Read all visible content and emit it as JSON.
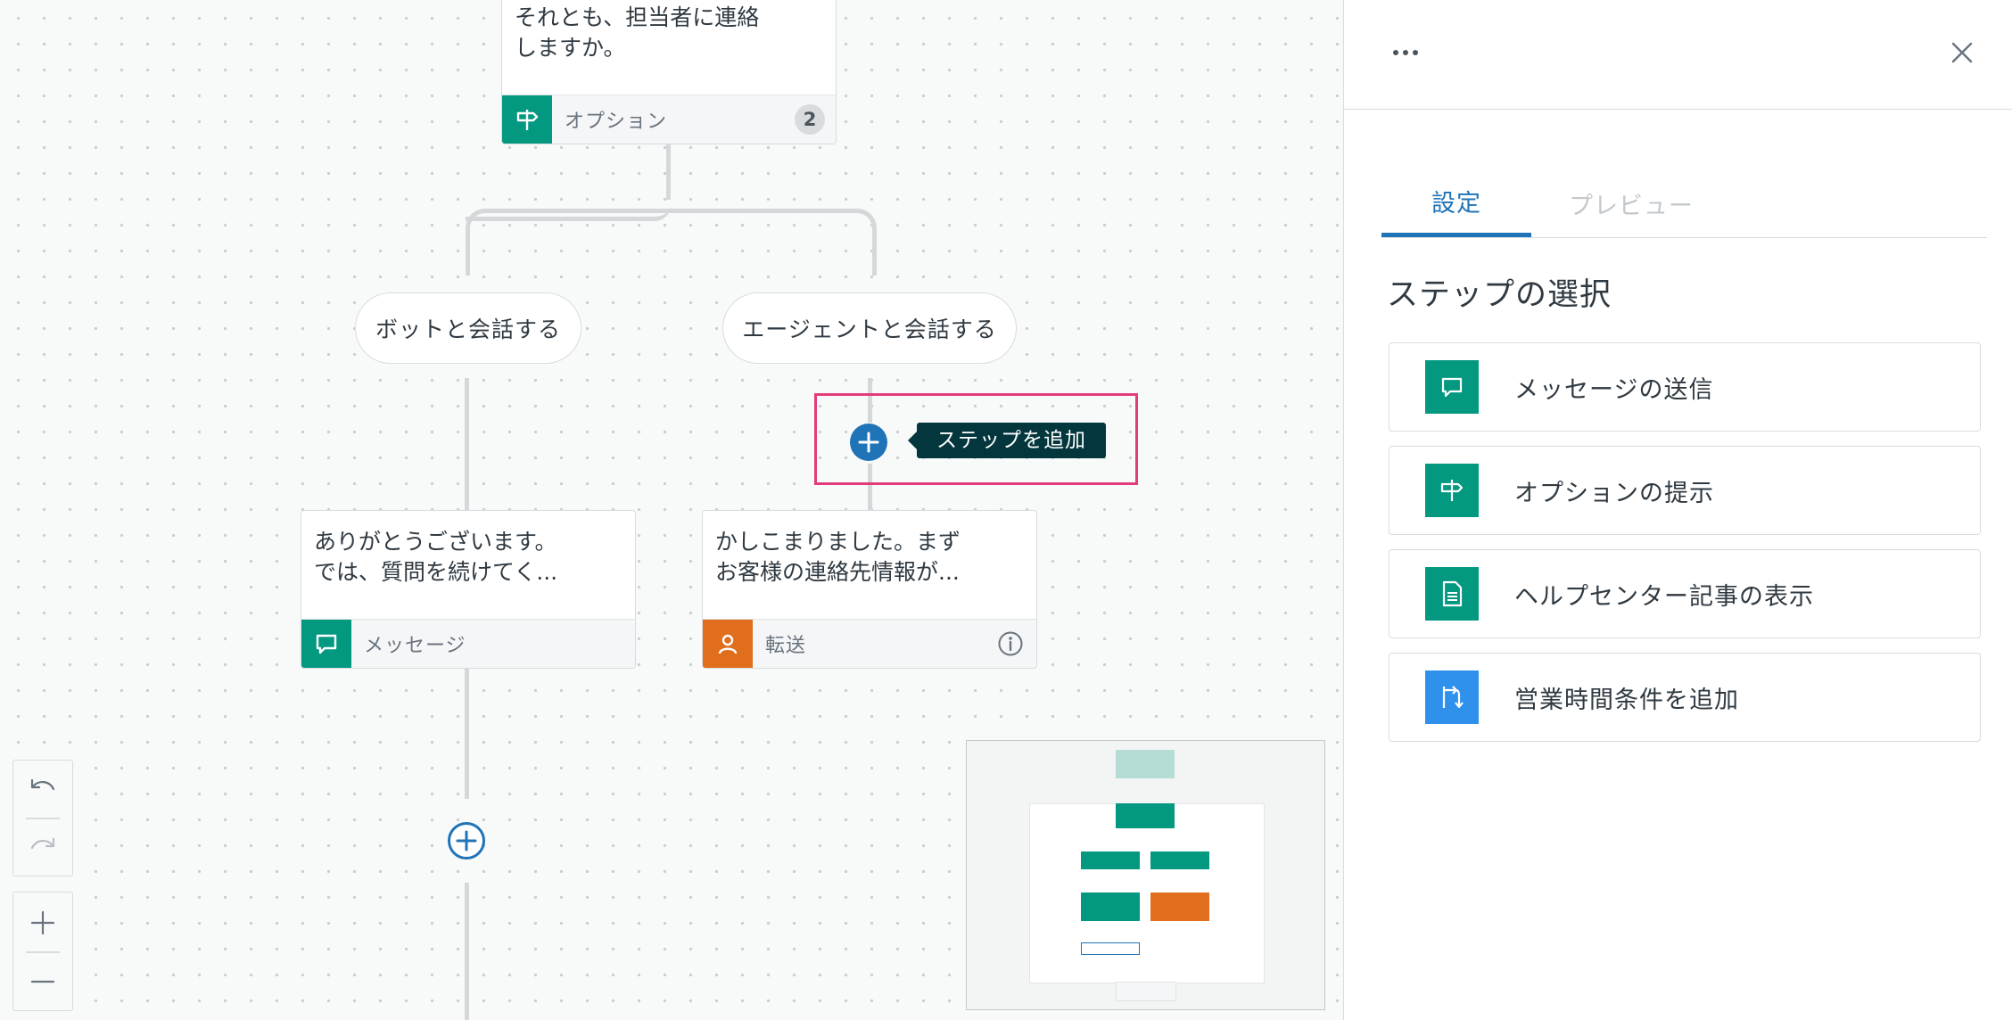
{
  "colors": {
    "teal": "#039981",
    "orange": "#e06e1c",
    "blue": "#1f73b7",
    "action_blue": "#3091ec",
    "tooltip_bg": "#03363d",
    "highlight": "#e23c7a"
  },
  "top_card": {
    "text": "それとも、担当者に連絡\nしますか。",
    "footer_label": "オプション",
    "badge": "2",
    "icon": "signpost-icon"
  },
  "branches": [
    {
      "label": "ボットと会話する"
    },
    {
      "label": "エージェントと会話する"
    }
  ],
  "left_card": {
    "text": "ありがとうございます。\nでは、質問を続けてく...",
    "footer_label": "メッセージ",
    "icon": "message-icon"
  },
  "right_card": {
    "text": "かしこまりました。まず\nお客様の連絡先情報が...",
    "footer_label": "転送",
    "icon": "person-icon",
    "info_icon": "info-icon"
  },
  "tooltip": {
    "text": "ステップを追加"
  },
  "controls": {
    "undo_icon": "undo-icon",
    "redo_icon": "redo-icon",
    "zoom_in_icon": "plus-icon",
    "zoom_out_icon": "minus-icon"
  },
  "panel": {
    "more_icon": "more-icon",
    "close_icon": "close-icon",
    "tabs": [
      {
        "label": "設定",
        "active": true
      },
      {
        "label": "プレビュー",
        "active": false
      }
    ],
    "section_title": "ステップの選択",
    "options": [
      {
        "label": "メッセージの送信",
        "icon": "message-icon",
        "color": "#039981"
      },
      {
        "label": "オプションの提示",
        "icon": "signpost-icon",
        "color": "#039981"
      },
      {
        "label": "ヘルプセンター記事の表示",
        "icon": "document-icon",
        "color": "#039981"
      },
      {
        "label": "営業時間条件を追加",
        "icon": "branch-icon",
        "color": "#3091ec"
      }
    ]
  }
}
